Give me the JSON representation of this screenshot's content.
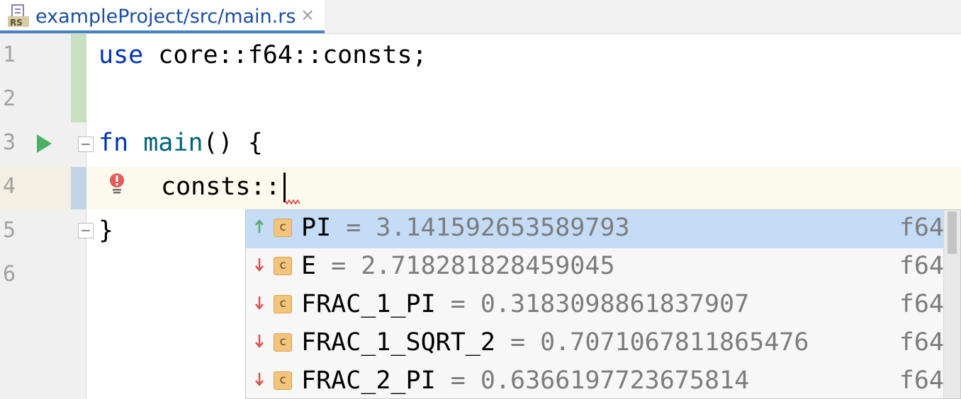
{
  "tab": {
    "title": "exampleProject/src/main.rs",
    "icon_text": "RS",
    "close": "×"
  },
  "editor": {
    "line_numbers": [
      "1",
      "2",
      "3",
      "4",
      "5",
      "6"
    ],
    "lines": {
      "l1_kw": "use",
      "l1_rest": " core::f64::consts;",
      "l3_kw": "fn",
      "l3_name": "main",
      "l3_rest": "() {",
      "l4_text": "consts::",
      "l5_text": "}"
    }
  },
  "completion": {
    "items": [
      {
        "name": "PI",
        "value": " = 3.141592653589793",
        "type": "f64",
        "arrow": "up",
        "badge": "c",
        "selected": true
      },
      {
        "name": "E",
        "value": " = 2.718281828459045",
        "type": "f64",
        "arrow": "down",
        "badge": "c",
        "selected": false
      },
      {
        "name": "FRAC_1_PI",
        "value": " = 0.3183098861837907",
        "type": "f64",
        "arrow": "down",
        "badge": "c",
        "selected": false
      },
      {
        "name": "FRAC_1_SQRT_2",
        "value": " = 0.7071067811865476",
        "type": "f64",
        "arrow": "down",
        "badge": "c",
        "selected": false
      },
      {
        "name": "FRAC_2_PI",
        "value": " = 0.6366197723675814",
        "type": "f64",
        "arrow": "down",
        "badge": "c",
        "selected": false
      }
    ]
  },
  "colors": {
    "keyword": "#0033b3",
    "function": "#00627a",
    "selection": "#c5dcf7",
    "arrow_up": "#5aa86b",
    "arrow_down": "#d9534f",
    "run": "#4caf63"
  }
}
